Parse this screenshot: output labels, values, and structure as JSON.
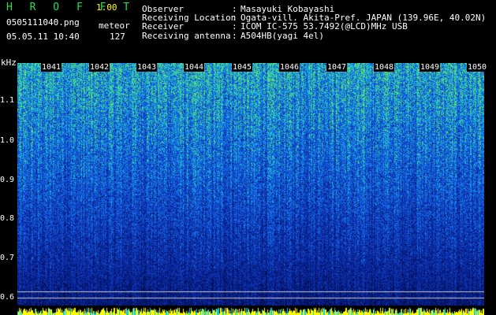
{
  "header": {
    "brand": "H R O F F T",
    "version": "1.00",
    "filename": "0505111040.png",
    "datetime": "05.05.11 10:40",
    "counter_label": "meteor",
    "counter_value": "127"
  },
  "info": [
    {
      "label": "Observer",
      "value": "Masayuki Kobayashi"
    },
    {
      "label": "Receiving Location",
      "value": "Ogata-vill. Akita-Pref. JAPAN (139.96E, 40.02N)"
    },
    {
      "label": "Receiver",
      "value": "ICOM IC-575 53.7492(@LCD)MHz USB"
    },
    {
      "label": "Receiving antenna",
      "value": "A504HB(yagi 4el)"
    }
  ],
  "spectrogram": {
    "unit": "kHz",
    "y_ticks": [
      "1.1",
      "1.0",
      "0.9",
      "0.8",
      "0.7",
      "0.6"
    ],
    "minute_labels": [
      "1041",
      "1042",
      "1043",
      "1044",
      "1045",
      "1046",
      "1047",
      "1048",
      "1049",
      "1050"
    ]
  },
  "colors": {
    "background": "#000000",
    "label_green": "#22e055",
    "count_yellow": "#ffff00",
    "text_white": "#ffffff"
  }
}
